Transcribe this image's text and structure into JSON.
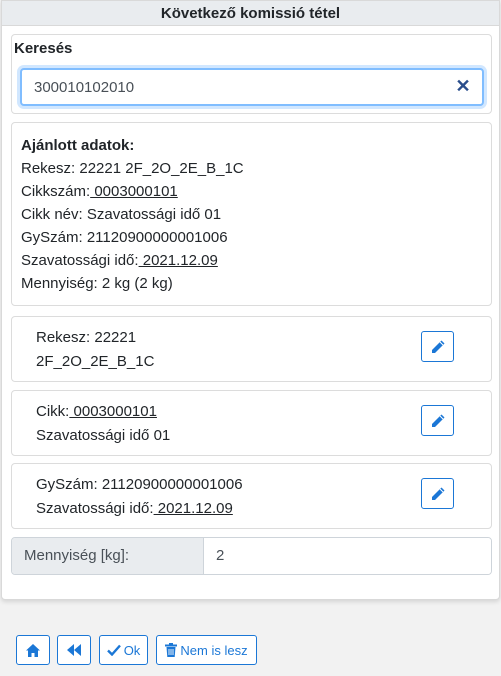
{
  "title": "Következő komissió tétel",
  "search": {
    "label": "Keresés",
    "value": "300010102010"
  },
  "suggested": {
    "heading": "Ajánlott adatok:",
    "rekesz": "Rekesz: 22221 2F_2O_2E_B_1C",
    "cikkszam_label": "Cikkszám:",
    "cikkszam_value": " 0003000101",
    "cikk_nev": "Cikk név: Szavatossági idő 01",
    "gyszam": "GySzám: 21120900000001006",
    "szav_label": "Szavatossági idő:",
    "szav_value": " 2021.12.09",
    "mennyiseg": "Mennyiség: 2 kg (2 kg)"
  },
  "cards": {
    "rekesz": {
      "line1": "Rekesz: 22221",
      "line2": "2F_2O_2E_B_1C"
    },
    "cikk": {
      "line1_label": "Cikk:",
      "line1_value": " 0003000101",
      "line2": "Szavatossági idő 01"
    },
    "gyszam": {
      "line1": "GySzám: 21120900000001006",
      "line2_label": "Szavatossági idő:",
      "line2_value": " 2021.12.09"
    }
  },
  "quantity": {
    "label": "Mennyiség [kg]:",
    "value": "2"
  },
  "footer": {
    "ok_label": "Ok",
    "cancel_label": "Nem is lesz"
  },
  "colors": {
    "accent": "#1b77d6",
    "clear_icon": "#2a4e8c"
  }
}
